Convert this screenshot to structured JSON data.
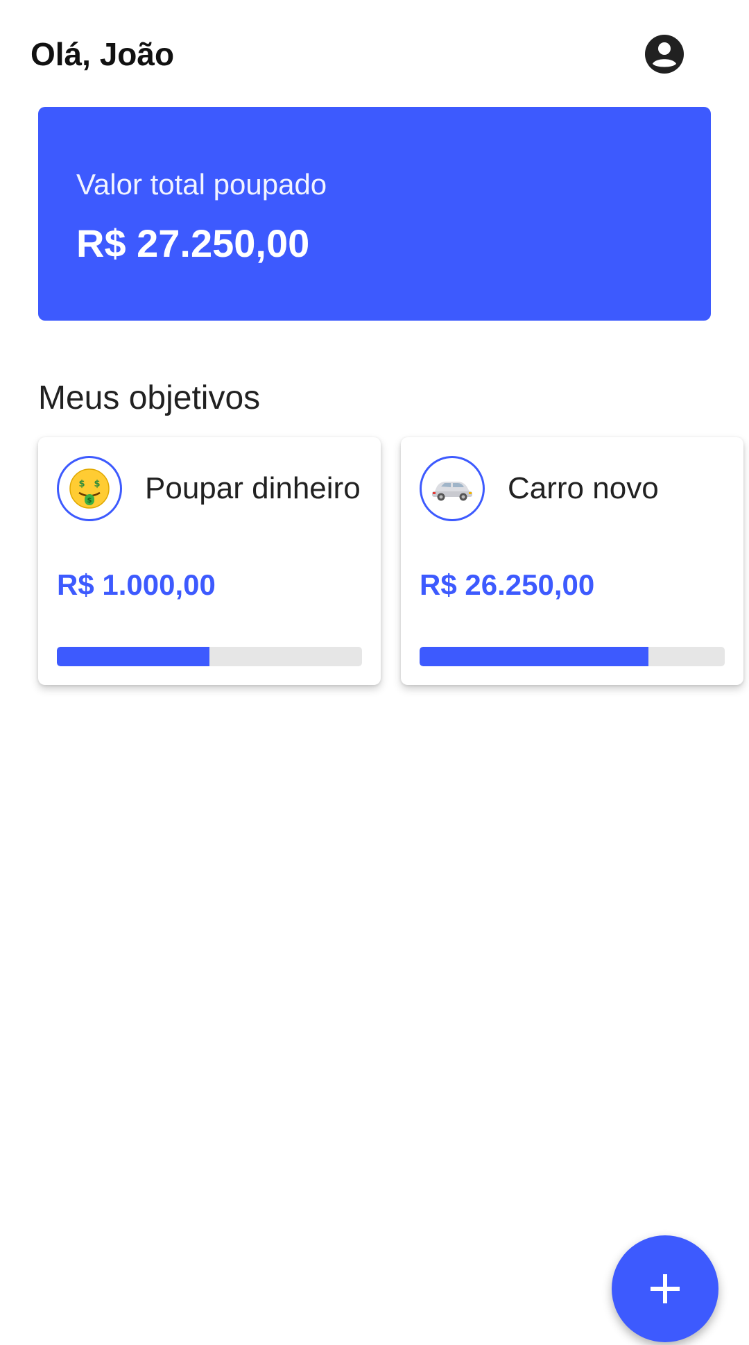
{
  "header": {
    "greeting": "Olá, João",
    "profile_icon": "account-circle-icon"
  },
  "summary": {
    "label": "Valor total poupado",
    "value": "R$ 27.250,00"
  },
  "goals_section": {
    "title": "Meus objetivos",
    "items": [
      {
        "name": "Poupar dinheiro",
        "amount": "R$ 1.000,00",
        "icon": "money-mouth-face-icon",
        "progress": 0.5
      },
      {
        "name": "Carro novo",
        "amount": "R$ 26.250,00",
        "icon": "car-icon",
        "progress": 0.75
      }
    ]
  },
  "fab": {
    "icon": "plus-icon"
  },
  "colors": {
    "accent": "#3d5afe",
    "track": "#e6e6e6",
    "text": "#212121"
  }
}
